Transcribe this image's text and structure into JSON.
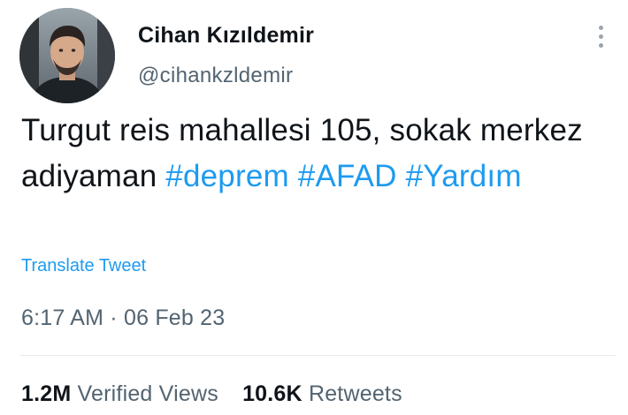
{
  "user": {
    "name": "Cihan Kızıldemir",
    "handle": "@cihankzldemir",
    "avatar": "profile-photo"
  },
  "tweet": {
    "text_plain": "Turgut reis mahallesi 105, sokak merkez adiyaman",
    "hashtags": [
      "#deprem",
      "#AFAD",
      "#Yardım"
    ],
    "translate_label": "Translate Tweet",
    "time": "6:17 AM",
    "separator": "·",
    "date": "06 Feb 23"
  },
  "stats": {
    "views_count": "1.2M",
    "views_label": "Verified Views",
    "retweets_count": "10.6K",
    "retweets_label": "Retweets"
  },
  "icons": {
    "more": "more-vertical-icon"
  },
  "colors": {
    "link": "#1d9bf0",
    "text": "#0f1419",
    "secondary": "#536471"
  }
}
